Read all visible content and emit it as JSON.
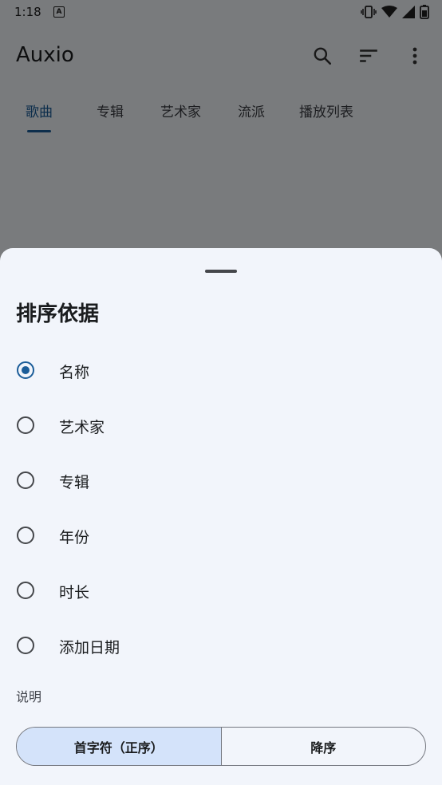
{
  "status_bar": {
    "time": "1:18",
    "notification_glyph": "A",
    "icons": [
      "vibrate-icon",
      "wifi-icon",
      "signal-icon",
      "battery-icon"
    ]
  },
  "app_bar": {
    "title": "Auxio",
    "actions": [
      "search-icon",
      "sort-icon",
      "overflow-menu-icon"
    ]
  },
  "tabs": [
    {
      "label": "歌曲",
      "active": true
    },
    {
      "label": "专辑",
      "active": false
    },
    {
      "label": "艺术家",
      "active": false
    },
    {
      "label": "流派",
      "active": false
    },
    {
      "label": "播放列表",
      "active": false
    }
  ],
  "sheet": {
    "title": "排序依据",
    "options": [
      {
        "label": "名称",
        "selected": true
      },
      {
        "label": "艺术家",
        "selected": false
      },
      {
        "label": "专辑",
        "selected": false
      },
      {
        "label": "年份",
        "selected": false
      },
      {
        "label": "时长",
        "selected": false
      },
      {
        "label": "添加日期",
        "selected": false
      }
    ],
    "direction_label": "说明",
    "direction": {
      "ascending": "首字符（正序）",
      "descending": "降序",
      "selected": "ascending"
    }
  },
  "colors": {
    "accent": "#1b5d99",
    "selected_segment": "#d4e3fa",
    "sheet_background": "#f2f5fb"
  }
}
